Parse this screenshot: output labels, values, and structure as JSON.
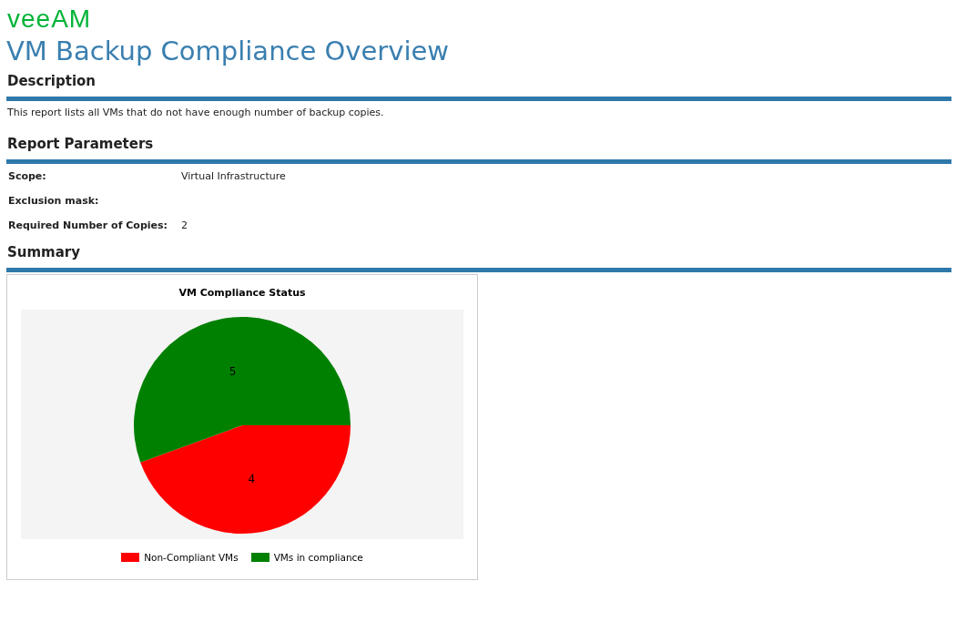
{
  "logo": "veeAM",
  "title": "VM Backup Compliance Overview",
  "description": {
    "heading": "Description",
    "text": "This report lists all VMs that do not have enough number of backup copies."
  },
  "parameters": {
    "heading": "Report Parameters",
    "rows": [
      {
        "label": "Scope:",
        "value": "Virtual Infrastructure"
      },
      {
        "label": "Exclusion mask:"
      },
      {
        "label": "Required Number of Copies:",
        "value": "2"
      }
    ]
  },
  "summary": {
    "heading": "Summary",
    "chart_data": {
      "type": "pie",
      "title": "VM Compliance Status",
      "categories": [
        "Non-Compliant VMs",
        "VMs in compliance"
      ],
      "values": [
        4,
        5
      ],
      "colors": [
        "#ff0000",
        "#008000"
      ],
      "data_labels": true,
      "legend": "bottom"
    }
  }
}
